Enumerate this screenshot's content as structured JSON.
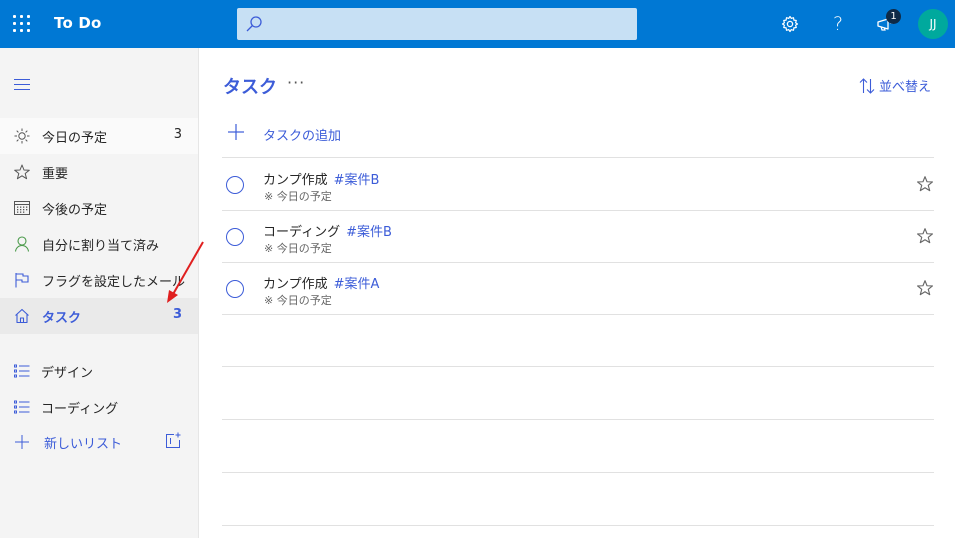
{
  "app": {
    "title": "To Do",
    "launcher_icon": "waffle-icon"
  },
  "search": {
    "placeholder": "",
    "value": "",
    "icon": "search-icon"
  },
  "topbar": {
    "settings_icon": "gear-icon",
    "help_icon": "question-icon",
    "whatsnew_icon": "megaphone-icon",
    "notification_count": "1",
    "avatar_initials": "JJ",
    "avatar_color": "#00a99d",
    "bar_color": "#0078d4"
  },
  "sidebar": {
    "menu_icon": "hamburger-icon",
    "smart_lists": [
      {
        "label": "今日の予定",
        "count": "3",
        "icon": "sun-icon"
      },
      {
        "label": "重要",
        "count": "",
        "icon": "star-icon"
      },
      {
        "label": "今後の予定",
        "count": "",
        "icon": "calendar-icon"
      },
      {
        "label": "自分に割り当て済み",
        "count": "",
        "icon": "person-icon"
      },
      {
        "label": "フラグを設定したメール",
        "count": "",
        "icon": "flag-icon"
      },
      {
        "label": "タスク",
        "count": "3",
        "icon": "home-icon",
        "active": true
      }
    ],
    "user_lists": [
      {
        "label": "デザイン",
        "icon": "list-icon"
      },
      {
        "label": "コーディング",
        "icon": "list-icon"
      }
    ],
    "new_list": {
      "label": "新しいリスト",
      "icon": "plus-icon",
      "group_icon": "new-group-icon"
    }
  },
  "main": {
    "title": "タスク",
    "more_label": "···",
    "sort_label": "並べ替え",
    "add_task_label": "タスクの追加",
    "accent": "#3c5cd8",
    "tasks": [
      {
        "title": "カンプ作成",
        "tag": "#案件B",
        "due": "今日の予定",
        "due_icon": "※"
      },
      {
        "title": "コーディング",
        "tag": "#案件B",
        "due": "今日の予定",
        "due_icon": "※"
      },
      {
        "title": "カンプ作成",
        "tag": "#案件A",
        "due": "今日の予定",
        "due_icon": "※"
      }
    ]
  },
  "annotation": {
    "type": "arrow",
    "color": "#e02020",
    "target": "sidebar-item-tasks-count"
  }
}
